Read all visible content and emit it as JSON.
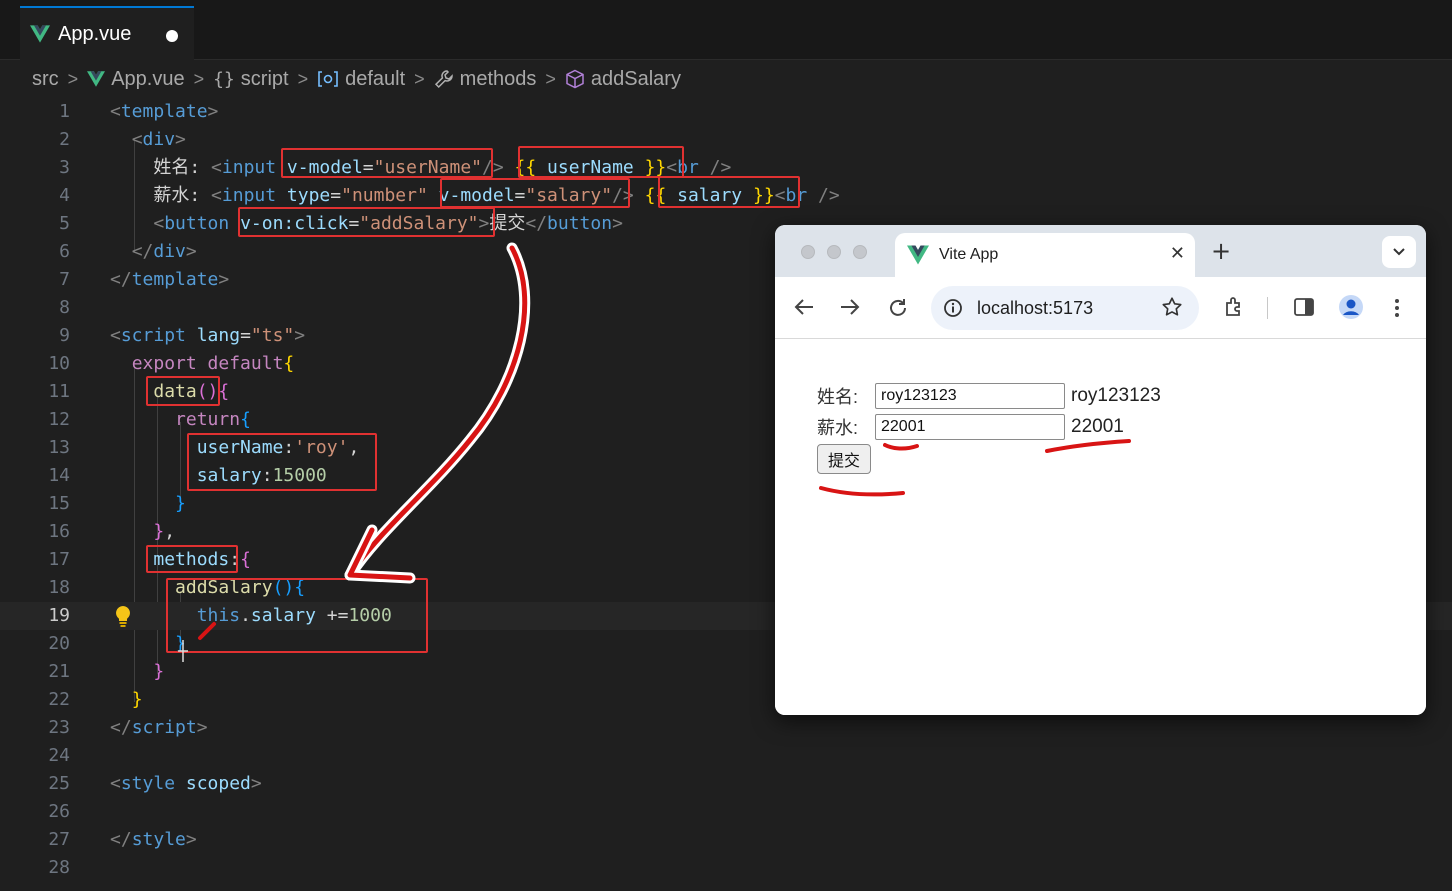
{
  "editor": {
    "tab": {
      "title": "App.vue"
    },
    "breadcrumb": [
      {
        "label": "src",
        "icon": "none"
      },
      {
        "label": "App.vue",
        "icon": "vue-logo-icon"
      },
      {
        "label": "script",
        "icon": "braces-icon"
      },
      {
        "label": "default",
        "icon": "module-icon"
      },
      {
        "label": "methods",
        "icon": "wrench-icon"
      },
      {
        "label": "addSalary",
        "icon": "cube-icon"
      }
    ],
    "current_line": 19,
    "line_numbers": [
      "1",
      "2",
      "3",
      "4",
      "5",
      "6",
      "7",
      "8",
      "9",
      "10",
      "11",
      "12",
      "13",
      "14",
      "15",
      "16",
      "17",
      "18",
      "19",
      "20",
      "21",
      "22",
      "23",
      "24",
      "25",
      "26",
      "27",
      "28"
    ],
    "code": {
      "l1_tag": "template",
      "l2_tag": "div",
      "l3_label": "姓名: ",
      "l3_input": "input",
      "l3_vmodel_attr": "v-model",
      "l3_vmodel_val": "\"userName\"",
      "l3_mustache": "userName",
      "l3_br": "br",
      "l4_label": "薪水: ",
      "l4_input": "input",
      "l4_type_attr": "type",
      "l4_type_val": "\"number\"",
      "l4_vmodel_attr": "v-model",
      "l4_vmodel_val": "\"salary\"",
      "l4_mustache": "salary",
      "l4_br": "br",
      "l5_button": "button",
      "l5_von_attr": "v-on:click",
      "l5_von_val": "\"addSalary\"",
      "l5_text": "提交",
      "l6_tag": "div",
      "l7_tag": "template",
      "l9_tag": "script",
      "l9_lang_attr": "lang",
      "l9_lang_val": "\"ts\"",
      "l10_export": "export default",
      "l11_data": "data",
      "l12_return": "return",
      "l13_key": "userName",
      "l13_val": "'roy'",
      "l14_key": "salary",
      "l14_val": "15000",
      "l17_methods": "methods",
      "l18_fn": "addSalary",
      "l19_this": "this",
      "l19_prop": "salary",
      "l19_op": " +=",
      "l19_val": "1000",
      "l23_tag": "script",
      "l25_tag": "style",
      "l25_attr": "scoped",
      "l27_tag": "style"
    }
  },
  "browser": {
    "tab_title": "Vite App",
    "url": "localhost:5173",
    "form": {
      "name_label": "姓名:",
      "name_value": "roy123123",
      "name_echo": "roy123123",
      "salary_label": "薪水:",
      "salary_value": "22001",
      "salary_echo": "22001",
      "submit_label": "提交"
    }
  },
  "colors": {
    "editor_bg": "#1f1f1f",
    "annotation_red": "#e03131",
    "vue_green": "#41b883"
  }
}
